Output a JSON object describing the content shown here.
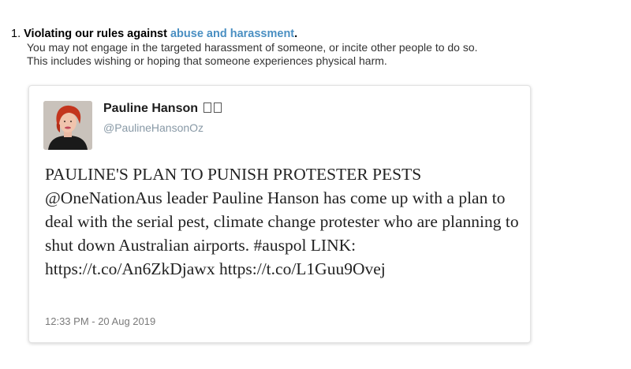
{
  "rule": {
    "number": "1.",
    "title_prefix": "Violating our rules against",
    "title_link": "abuse and harassment",
    "title_suffix": ".",
    "body_line1": "You may not engage in the targeted harassment of someone, or incite other people to do so.",
    "body_line2": "This includes wishing or hoping that someone experiences physical harm."
  },
  "tweet": {
    "display_name": "Pauline Hanson",
    "handle": "@PaulineHansonOz",
    "text": "PAULINE'S PLAN TO PUNISH PROTESTER PESTS @OneNationAus leader Pauline Hanson has come up with a plan to deal with the serial pest, climate change protester who are planning to shut down Australian airports. #auspol LINK: https://t.co/An6ZkDjawx https://t.co/L1Guu9Ovej",
    "timestamp": "12:33 PM - 20 Aug 2019"
  },
  "colors": {
    "link": "#4a8fc2",
    "handle": "#8899a6",
    "timestamp": "#7a7a7a"
  }
}
